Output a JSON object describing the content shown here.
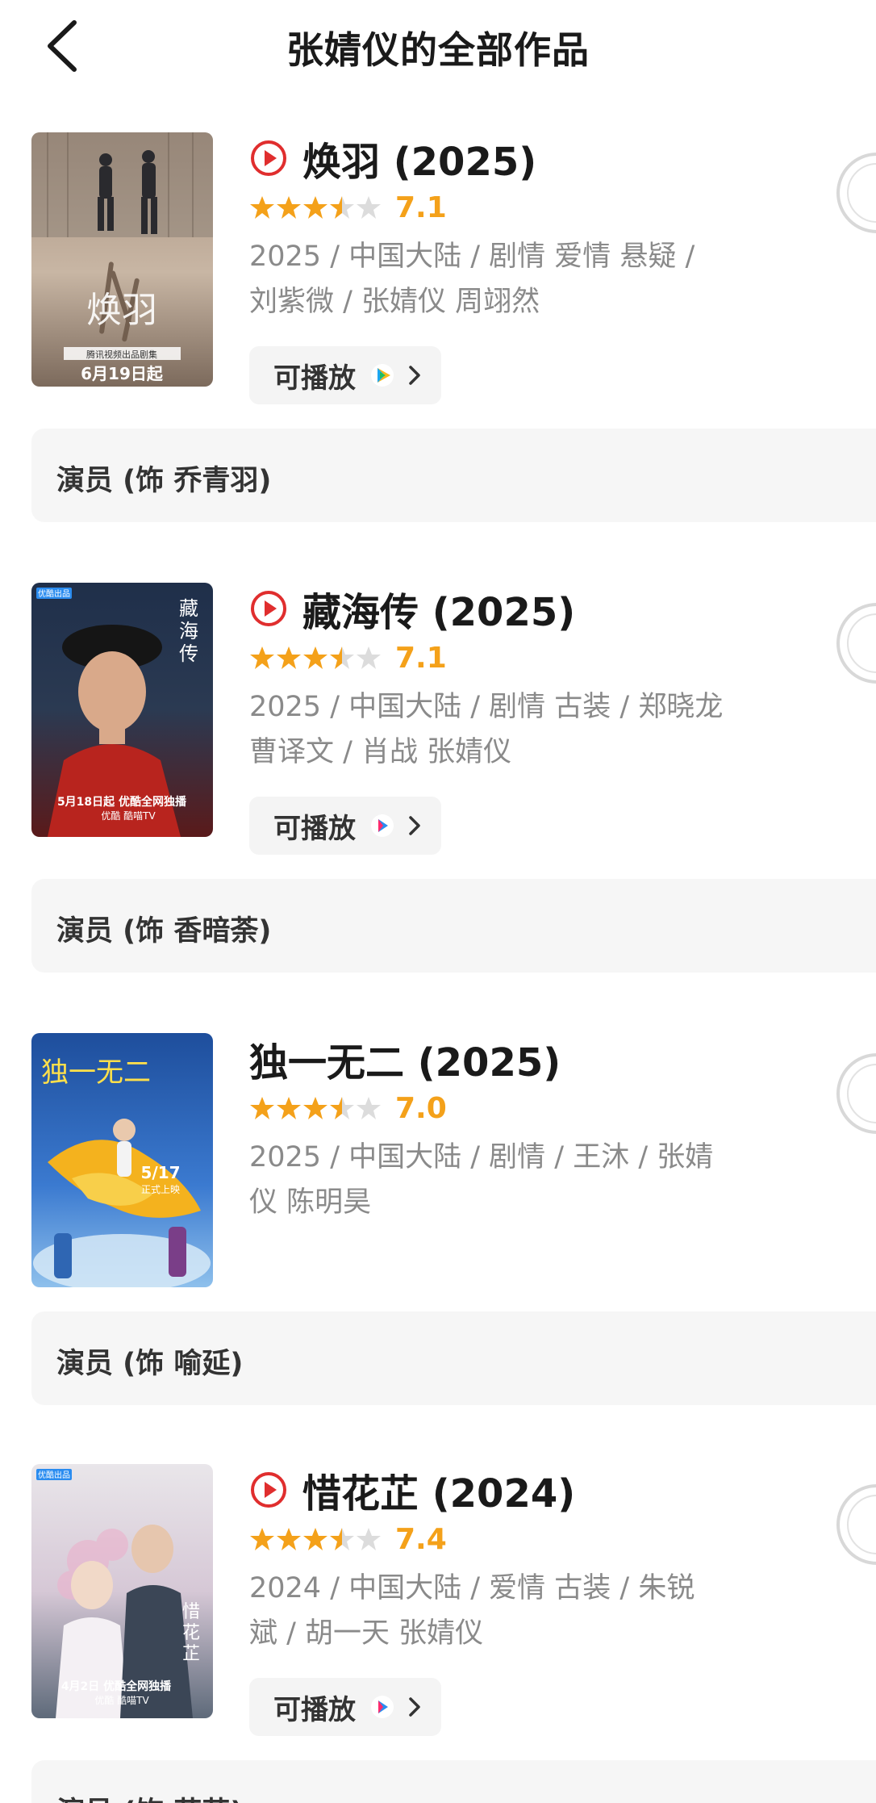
{
  "header": {
    "title": "张婧仪的全部作品"
  },
  "colors": {
    "accent": "#f4a11a",
    "play_red": "#e02e2e",
    "meta_gray": "#8a8a8a",
    "box_bg": "#f6f6f6"
  },
  "items": [
    {
      "title": "焕羽 (2025)",
      "has_play_icon": true,
      "rating": 7.1,
      "score": "7.1",
      "meta_line1": "2025 / 中国大陆 / 剧情 爱情 悬疑 /",
      "meta_line2": "刘紫微 / 张婧仪 周翊然",
      "play_label": "可播放",
      "platform": "tencent-video",
      "role": "演员 (饰 乔青羽)",
      "poster_text": "6月19日起",
      "poster_sub": "腾讯视频出品剧集",
      "poster_calli": "焕羽"
    },
    {
      "title": "藏海传 (2025)",
      "has_play_icon": true,
      "rating": 7.1,
      "score": "7.1",
      "meta_line1": "2025 / 中国大陆 / 剧情 古装 / 郑晓龙",
      "meta_line2": "曹译文 / 肖战 张婧仪",
      "play_label": "可播放",
      "platform": "youku",
      "role": "演员 (饰 香暗荼)",
      "poster_text": "5月18日起 优酷全网独播",
      "poster_sub": "优酷 酷喵TV",
      "poster_badge": "优酷出品",
      "poster_calli": "藏海传"
    },
    {
      "title": "独一无二 (2025)",
      "has_play_icon": false,
      "rating": 7.0,
      "score": "7.0",
      "meta_line1": "2025 / 中国大陆 / 剧情 / 王沐 / 张婧",
      "meta_line2": "仪 陈明昊",
      "role": "演员 (饰 喻延)",
      "poster_calli": "独一无二",
      "poster_date": "5/17",
      "poster_date_sub": "正式上映"
    },
    {
      "title": "惜花芷 (2024)",
      "has_play_icon": true,
      "rating": 7.4,
      "score": "7.4",
      "meta_line1": "2024 / 中国大陆 / 爱情 古装 / 朱锐",
      "meta_line2": "斌 / 胡一天 张婧仪",
      "play_label": "可播放",
      "platform": "youku",
      "role": "演员 (饰 花芷)",
      "poster_text": "4月2日 优酷全网独播",
      "poster_sub": "优酷 酷喵TV",
      "poster_badge": "优酷出品",
      "poster_calli": "惜花芷"
    }
  ]
}
